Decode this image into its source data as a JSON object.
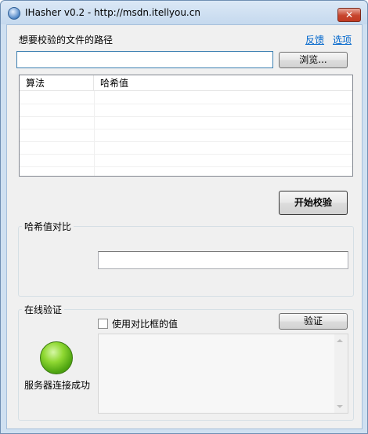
{
  "window": {
    "title": "IHasher v0.2 - http://msdn.itellyou.cn",
    "close_glyph": "✕",
    "icon": "app-globe-icon"
  },
  "file_section": {
    "label": "想要校验的文件的路径",
    "feedback_link": "反馈",
    "options_link": "选项",
    "path_value": "",
    "browse_button": "浏览..."
  },
  "hash_list": {
    "columns": [
      "算法",
      "哈希值"
    ],
    "rows": []
  },
  "start_button": "开始校验",
  "compare_group": {
    "title": "哈希值对比",
    "value": ""
  },
  "online_group": {
    "title": "在线验证",
    "checkbox_label": "使用对比框的值",
    "checkbox_checked": false,
    "verify_button": "验证",
    "status_text": "服务器连接成功",
    "status_color": "#5cb81a",
    "result_text": ""
  }
}
